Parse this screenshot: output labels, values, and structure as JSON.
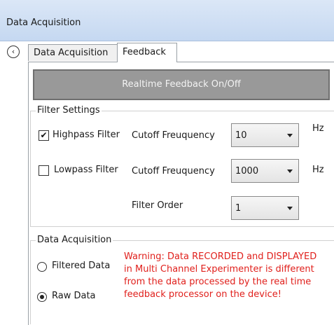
{
  "window": {
    "title": "Data Acquisition"
  },
  "tabs": [
    {
      "label": "Data Acquisition",
      "selected": false
    },
    {
      "label": "Feedback",
      "selected": true
    }
  ],
  "feedback_toggle": {
    "label": "Realtime Feedback On/Off"
  },
  "filter_settings": {
    "title": "Filter Settings",
    "highpass": {
      "label": "Highpass Filter",
      "checked": true,
      "cutoff_label": "Cutoff Freuquency",
      "cutoff_value": "10",
      "unit": "Hz"
    },
    "lowpass": {
      "label": "Lowpass Filter",
      "checked": false,
      "cutoff_label": "Cutoff Freuquency",
      "cutoff_value": "1000",
      "unit": "Hz"
    },
    "order": {
      "label": "Filter Order",
      "value": "1"
    }
  },
  "data_acquisition": {
    "title": "Data Acquisition",
    "options": [
      {
        "label": "Filtered Data",
        "selected": false
      },
      {
        "label": "Raw Data",
        "selected": true
      }
    ],
    "warning": "Warning: Data RECORDED and DISPLAYED in Multi Channel Experimenter is different from the data processed by the real time feedback processor on the device!"
  },
  "icons": {
    "back": "chevron-left-circle-icon",
    "checkmark": "checkmark-icon",
    "dropdown": "chevron-down-icon"
  },
  "colors": {
    "titlebar": "#c5d8f1",
    "toggle_button": "#999999",
    "warning_text": "#e0201c"
  }
}
